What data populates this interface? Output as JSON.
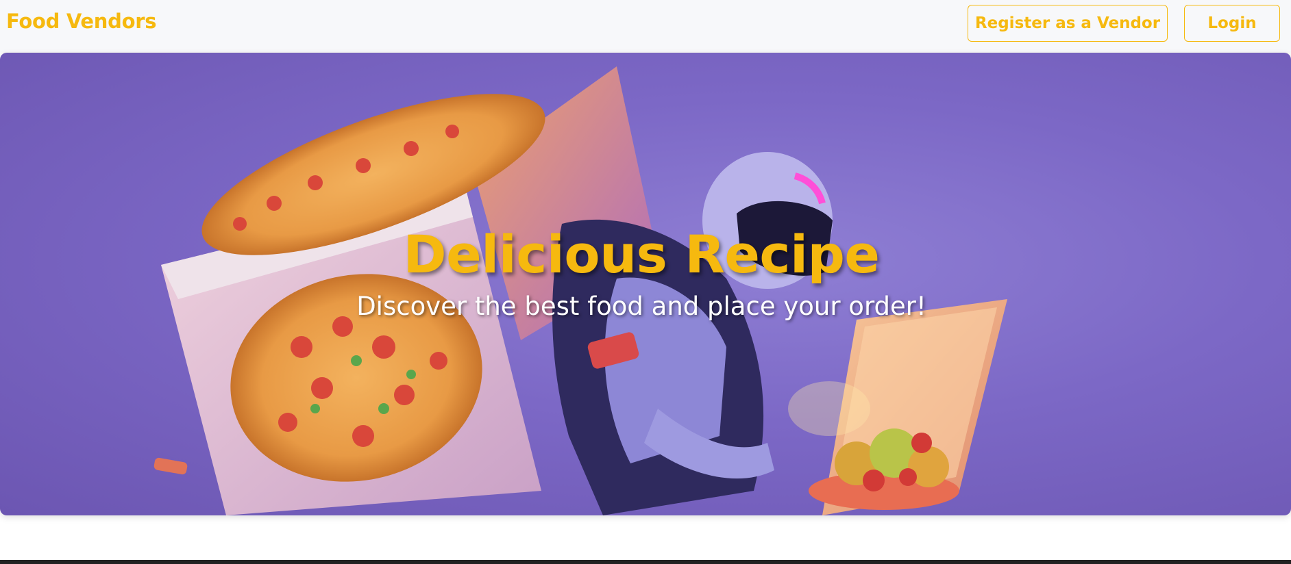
{
  "navbar": {
    "brand": "Food Vendors",
    "register_label": "Register as a Vendor",
    "login_label": "Login"
  },
  "hero": {
    "title": "Delicious Recipe",
    "subtitle": "Discover the best food and place your order!",
    "image_subject": "delivery-robot-with-pizza-boxes"
  },
  "colors": {
    "accent": "#f6b90f",
    "hero_background": "#7c68c6",
    "navbar_background": "#f7f8fa"
  }
}
